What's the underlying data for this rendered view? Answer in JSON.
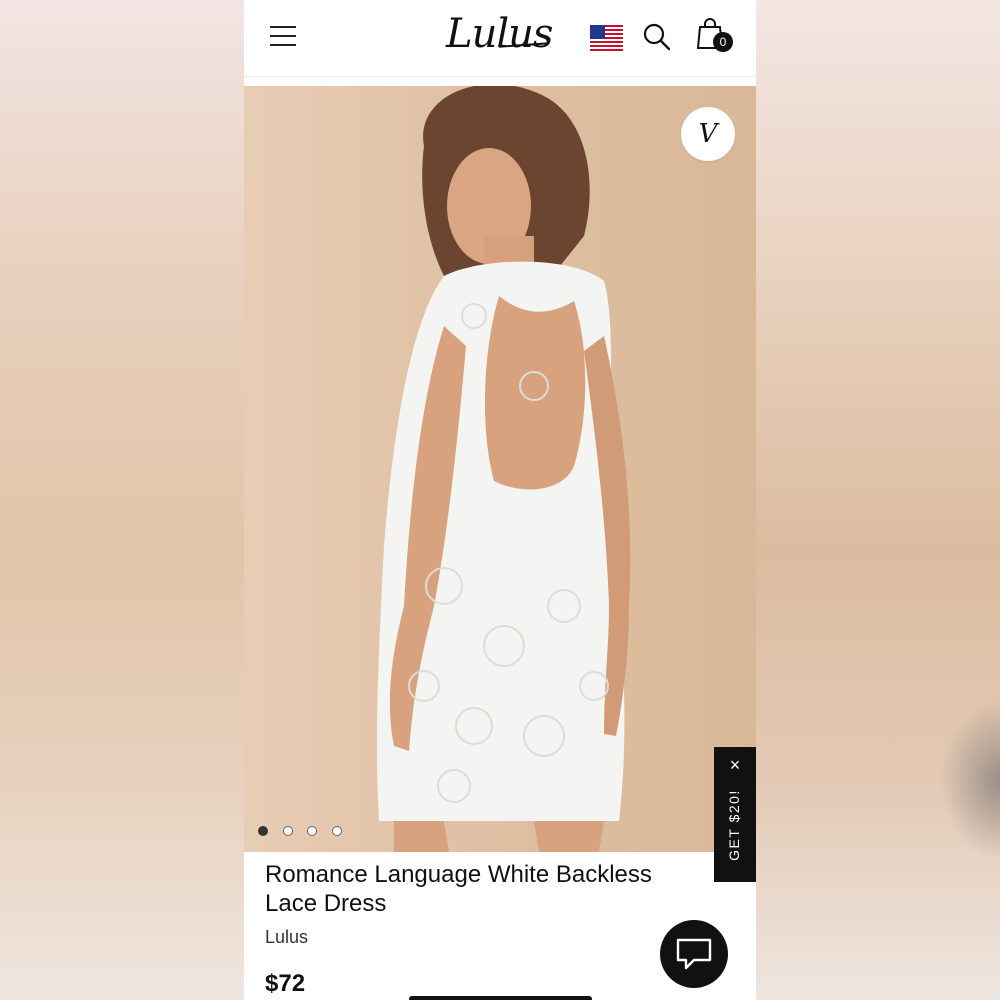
{
  "header": {
    "logo_text": "Lulus",
    "cart_count": "0",
    "icons": [
      "menu-icon",
      "us-flag-icon",
      "search-icon",
      "shopping-bag-icon"
    ]
  },
  "hero": {
    "wishlist_icon": "heart-v-icon",
    "wishlist_glyph": "V",
    "dots_count": 4,
    "active_dot_index": 0
  },
  "promo": {
    "label": "GET $20!",
    "close_glyph": "×"
  },
  "product": {
    "title": "Romance Language White Backless Lace Dress",
    "brand": "Lulus",
    "price": "$72"
  },
  "chat": {
    "icon": "chat-bubble-icon"
  },
  "colors": {
    "accent": "#111111",
    "background": "#ffffff",
    "hero_bg": "#dfc0a3"
  }
}
